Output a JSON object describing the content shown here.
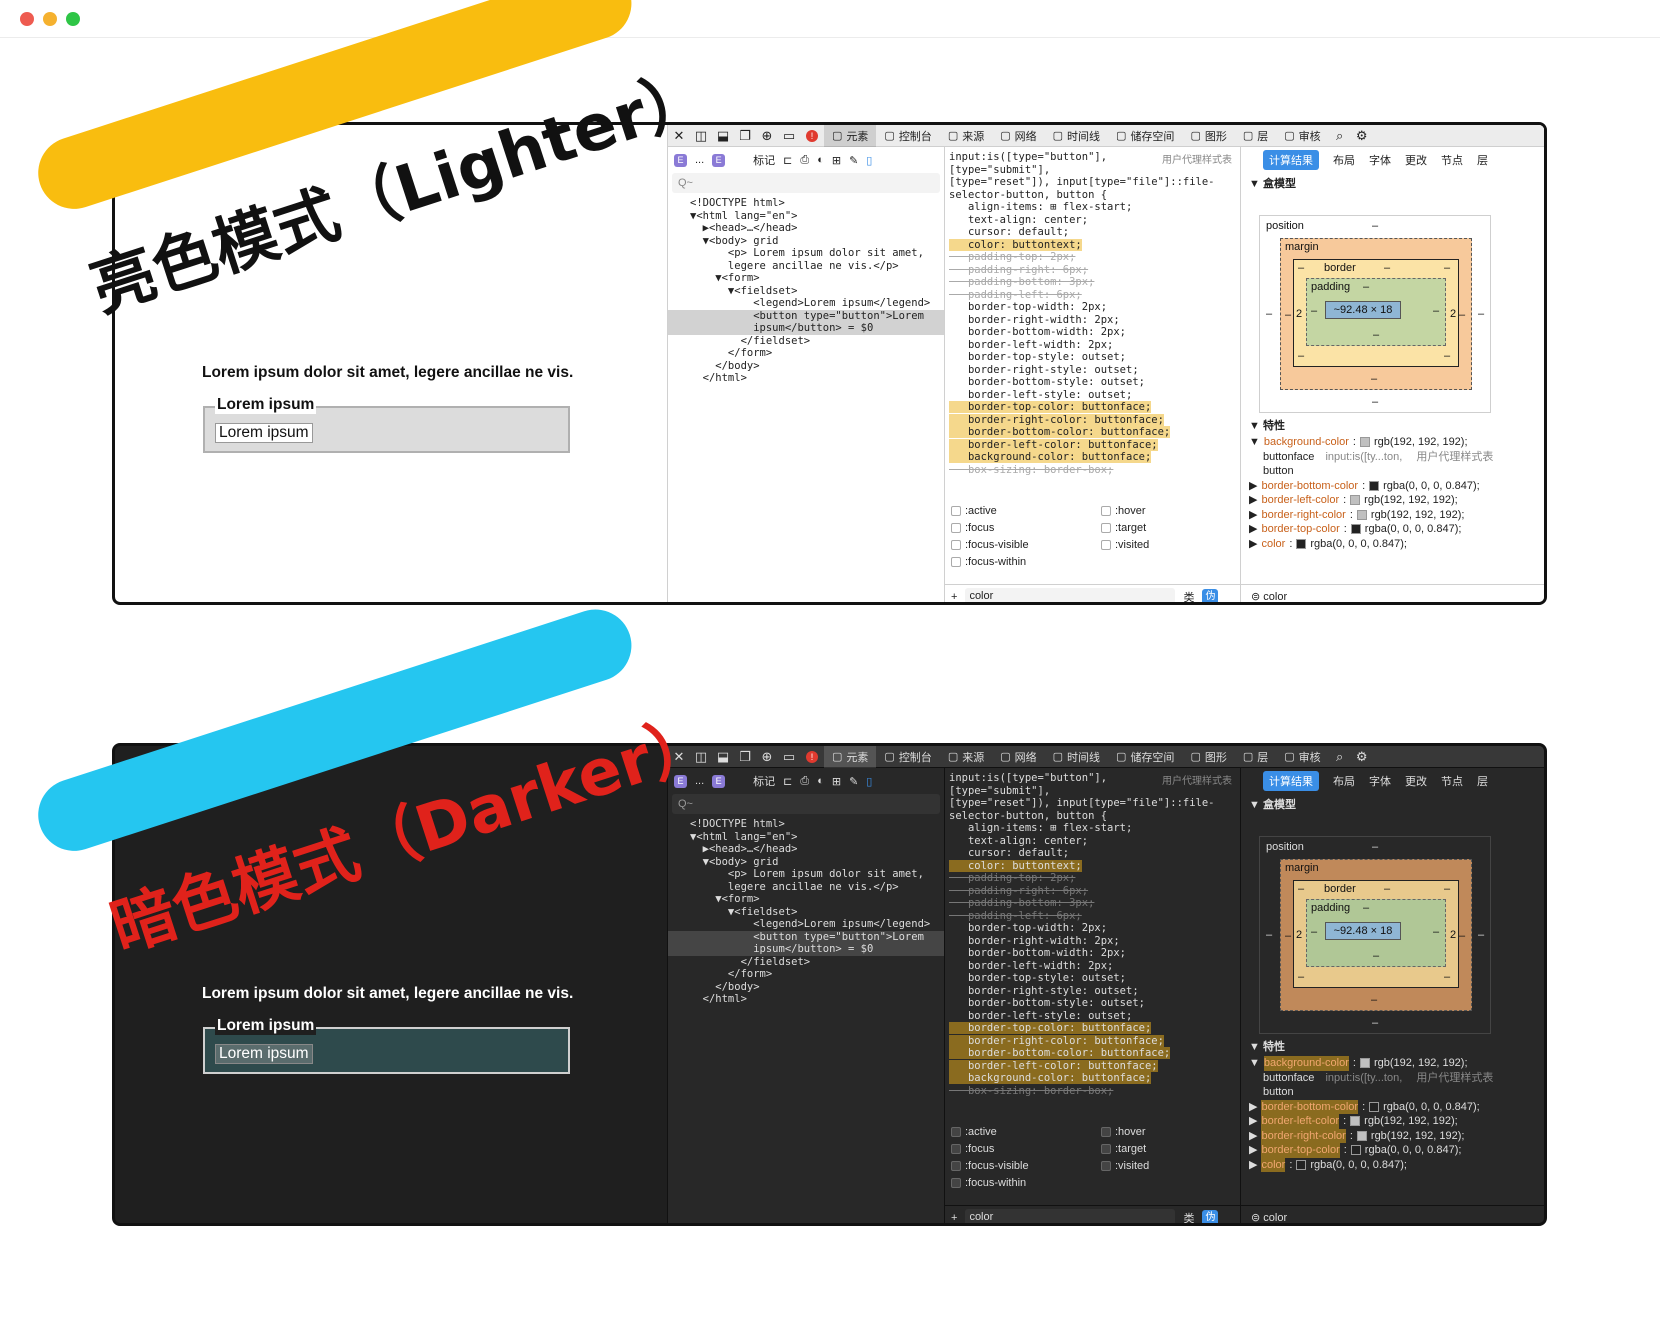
{
  "window": {
    "traffic": [
      "#ee5b50",
      "#f5b12f",
      "#2ec546"
    ]
  },
  "banners": {
    "light": "亮色模式（Lighter）",
    "dark": "暗色模式（Darker）",
    "light_color": "#f9bd0f",
    "dark_color": "#25c6f0",
    "dark_text_color": "#e0221b"
  },
  "page": {
    "paragraph": "Lorem ipsum dolor sit amet, legere ancillae ne vis.",
    "legend": "Lorem ipsum",
    "button": "Lorem ipsum"
  },
  "devtools": {
    "tabs": [
      "元素",
      "控制台",
      "来源",
      "网络",
      "时间线",
      "储存空间",
      "图形",
      "层",
      "审核"
    ],
    "crumb": {
      "mark": "标记",
      "dots": "..."
    },
    "search_placeholder": "Q~",
    "dom": [
      "<!DOCTYPE html>",
      "▼<html lang=\"en\">",
      "  ▶<head>…</head>",
      "  ▼<body> grid",
      "      <p> Lorem ipsum dolor sit amet,",
      "      legere ancillae ne vis.</p>",
      "    ▼<form>",
      "      ▼<fieldset>",
      "          <legend>Lorem ipsum</legend>",
      "          <button type=\"button\">Lorem",
      "          ipsum</button> = $0",
      "        </fieldset>",
      "      </form>",
      "    </body>",
      "  </html>"
    ],
    "rules_ua": "用户代理样式表",
    "rules": [
      {
        "t": "input:is([type=\"button\"],",
        "s": ""
      },
      {
        "t": "[type=\"submit\"],",
        "s": ""
      },
      {
        "t": "[type=\"reset\"]), input[type=\"file\"]::file-",
        "s": ""
      },
      {
        "t": "selector-button, button {",
        "s": ""
      },
      {
        "t": "   align-items: ⊞ flex-start;",
        "s": "dim"
      },
      {
        "t": "   text-align: center;",
        "s": "dim"
      },
      {
        "t": "   cursor: default;",
        "s": "dim"
      },
      {
        "t": "   color: buttontext;",
        "s": "hl"
      },
      {
        "t": "   padding-top: 2px;",
        "s": "strike"
      },
      {
        "t": "   padding-right: 6px;",
        "s": "strike"
      },
      {
        "t": "   padding-bottom: 3px;",
        "s": "strike"
      },
      {
        "t": "   padding-left: 6px;",
        "s": "strike"
      },
      {
        "t": "   border-top-width: 2px;",
        "s": "dim"
      },
      {
        "t": "   border-right-width: 2px;",
        "s": "dim"
      },
      {
        "t": "   border-bottom-width: 2px;",
        "s": "dim"
      },
      {
        "t": "   border-left-width: 2px;",
        "s": "dim"
      },
      {
        "t": "   border-top-style: outset;",
        "s": "dim"
      },
      {
        "t": "   border-right-style: outset;",
        "s": "dim"
      },
      {
        "t": "   border-bottom-style: outset;",
        "s": "dim"
      },
      {
        "t": "   border-left-style: outset;",
        "s": "dim"
      },
      {
        "t": "   border-top-color: buttonface;",
        "s": "hl"
      },
      {
        "t": "   border-right-color: buttonface;",
        "s": "hl"
      },
      {
        "t": "   border-bottom-color: buttonface;",
        "s": "hl"
      },
      {
        "t": "   border-left-color: buttonface;",
        "s": "hl"
      },
      {
        "t": "   background-color: buttonface;",
        "s": "hl"
      },
      {
        "t": "   box-sizing: border-box;",
        "s": "strike"
      }
    ],
    "pseudo": [
      ":active",
      ":hover",
      ":focus",
      ":target",
      ":focus-visible",
      ":visited",
      ":focus-within"
    ],
    "filter": "color",
    "class_label": "类",
    "pseudo_btn": "伪",
    "comp_tabs": [
      "计算结果",
      "布局",
      "字体",
      "更改",
      "节点",
      "层"
    ],
    "boxmodel_title": "盒模型",
    "bm": {
      "position": "position",
      "margin": "margin",
      "border": "border",
      "padding": "padding",
      "content": "~92.48 × 18",
      "dash": "–",
      "two": "2"
    },
    "props_title": "特性",
    "props": [
      {
        "name": "background-color",
        "value": "rgb(192, 192, 192);",
        "color": "#c0c0c0"
      },
      {
        "name": "border-bottom-color",
        "value": "rgba(0, 0, 0, 0.847);",
        "color": "#222222"
      },
      {
        "name": "border-left-color",
        "value": "rgb(192, 192, 192);",
        "color": "#c0c0c0"
      },
      {
        "name": "border-right-color",
        "value": "rgb(192, 192, 192);",
        "color": "#c0c0c0"
      },
      {
        "name": "border-top-color",
        "value": "rgba(0, 0, 0, 0.847);",
        "color": "#222222"
      },
      {
        "name": "color",
        "value": "rgba(0, 0, 0, 0.847);",
        "color": "#222222"
      }
    ],
    "prop_sub": {
      "a": "buttonface",
      "b": "input:is([ty...ton,",
      "c": "用户代理样式表",
      "d": "button"
    }
  }
}
